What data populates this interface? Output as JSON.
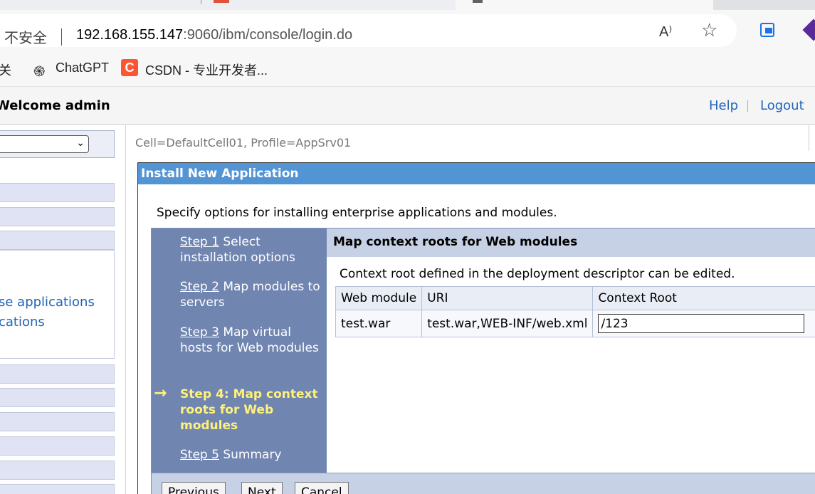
{
  "browser": {
    "security_label": "不安全",
    "url_host": "192.168.155.147",
    "url_path": ":9060/ibm/console/login.do",
    "read_aloud_icon_glyph": "A⁾",
    "bookmarks": [
      {
        "label": "关",
        "icon": "folder-icon"
      },
      {
        "label": "ChatGPT",
        "icon": "chatgpt-icon"
      },
      {
        "label": "CSDN - 专业开发者...",
        "icon": "csdn-icon"
      }
    ],
    "accent_color": "#1a73e8"
  },
  "header": {
    "welcome": "Welcome admin",
    "help": "Help",
    "logout": "Logout"
  },
  "nav": {
    "links": [
      "se applications",
      "cations"
    ]
  },
  "breadcrumb": "Cell=DefaultCell01, Profile=AppSrv01",
  "panel": {
    "title": "Install New Application",
    "intro": "Specify options for installing enterprise applications and modules.",
    "title_bar_color": "#5394d4"
  },
  "wizard": {
    "steps": [
      {
        "link": "Step 1",
        "text": " Select installation options"
      },
      {
        "link": "Step 2",
        "text": " Map modules to servers"
      },
      {
        "link": "Step 3",
        "text": " Map virtual hosts for Web modules"
      },
      {
        "link": "",
        "text": "Step 4: Map context roots for Web modules"
      },
      {
        "link": "Step 5",
        "text": " Summary"
      }
    ],
    "current_step_arrow": "→",
    "content_title": "Map context roots for Web modules",
    "content_desc": "Context root defined in the deployment descriptor can be edited.",
    "table": {
      "headers": [
        "Web module",
        "URI",
        "Context Root"
      ],
      "rows": [
        {
          "web_module": "test.war",
          "uri": "test.war,WEB-INF/web.xml",
          "context_root": "/123"
        }
      ]
    },
    "buttons": {
      "previous": "Previous",
      "next": "Next",
      "cancel": "Cancel"
    }
  }
}
